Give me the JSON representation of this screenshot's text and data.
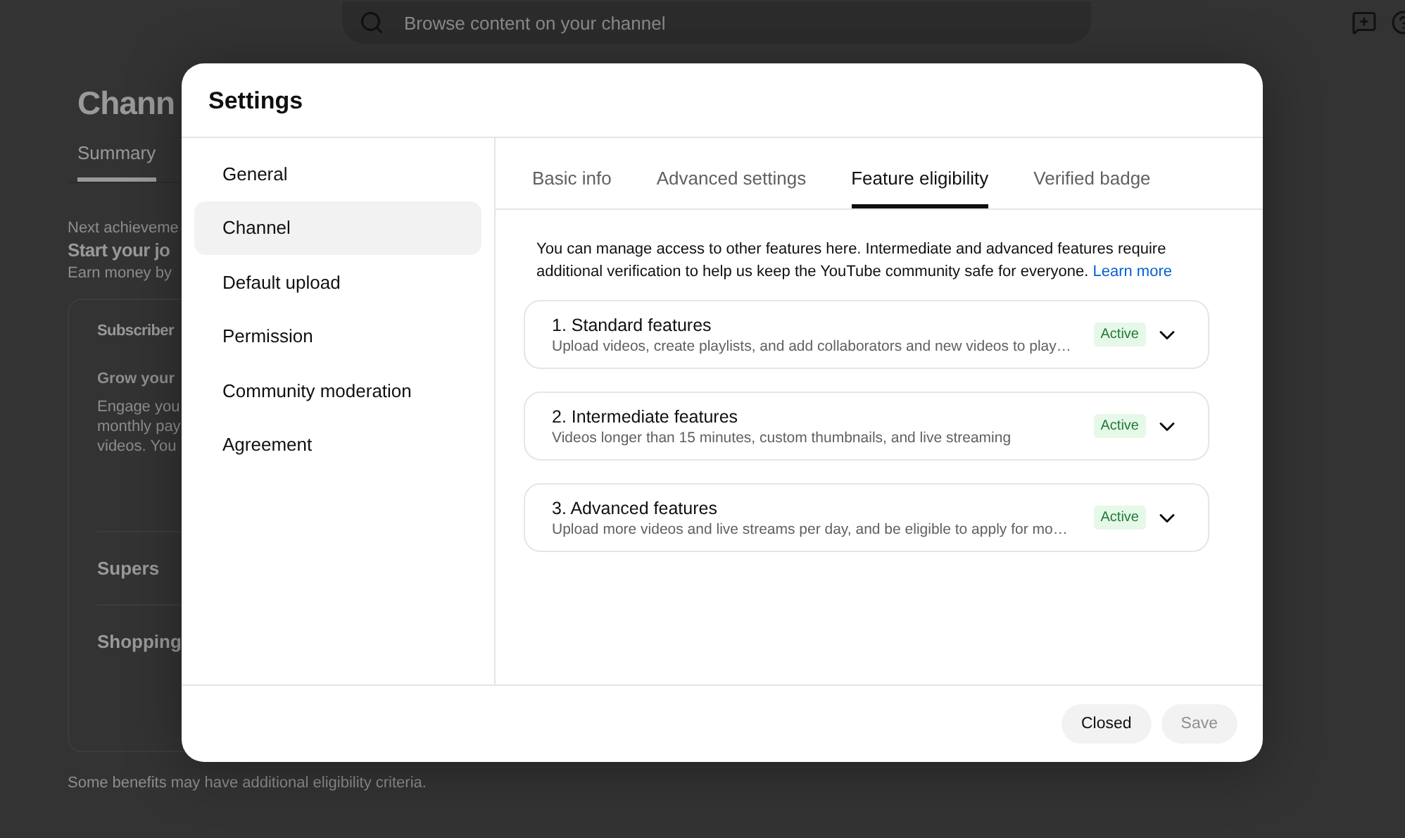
{
  "background": {
    "search": {
      "placeholder": "Browse content on your channel"
    },
    "page_title": "Chann",
    "tabs": [
      {
        "label": "Summary",
        "selected": true
      }
    ],
    "next_label": "Next achieveme",
    "heading": "Start your jo",
    "subheading": "Earn money by",
    "card": {
      "title": "Subscriber",
      "subtitle": "Grow your",
      "body": [
        "Engage you",
        "monthly pay",
        "videos. You"
      ],
      "rows": [
        "Supers",
        "Shopping"
      ]
    },
    "footnote": "Some benefits may have additional eligibility criteria."
  },
  "dialog": {
    "title": "Settings",
    "sidebar": {
      "items": [
        {
          "label": "General",
          "selected": false
        },
        {
          "label": "Channel",
          "selected": true
        },
        {
          "label": "Default upload",
          "selected": false
        },
        {
          "label": "Permission",
          "selected": false
        },
        {
          "label": "Community moderation",
          "selected": false
        },
        {
          "label": "Agreement",
          "selected": false
        }
      ]
    },
    "tabs": [
      {
        "label": "Basic info",
        "selected": false
      },
      {
        "label": "Advanced settings",
        "selected": false
      },
      {
        "label": "Feature eligibility",
        "selected": true
      },
      {
        "label": "Verified badge",
        "selected": false
      }
    ],
    "intro": "You can manage access to other features here. Intermediate and advanced features require additional verification to help us keep the YouTube community safe for everyone.",
    "intro_link": "Learn more",
    "features": [
      {
        "title": "1. Standard features",
        "description": "Upload videos, create playlists, and add collaborators and new videos to play…",
        "status": "Active",
        "expanded": false
      },
      {
        "title": "2. Intermediate features",
        "description": "Videos longer than 15 minutes, custom thumbnails, and live streaming",
        "status": "Active",
        "expanded": false
      },
      {
        "title": "3. Advanced features",
        "description": "Upload more videos and live streams per day, and be eligible to apply for mo…",
        "status": "Active",
        "expanded": false
      }
    ],
    "buttons": [
      {
        "label": "Closed",
        "disabled": false
      },
      {
        "label": "Save",
        "disabled": true
      }
    ]
  }
}
